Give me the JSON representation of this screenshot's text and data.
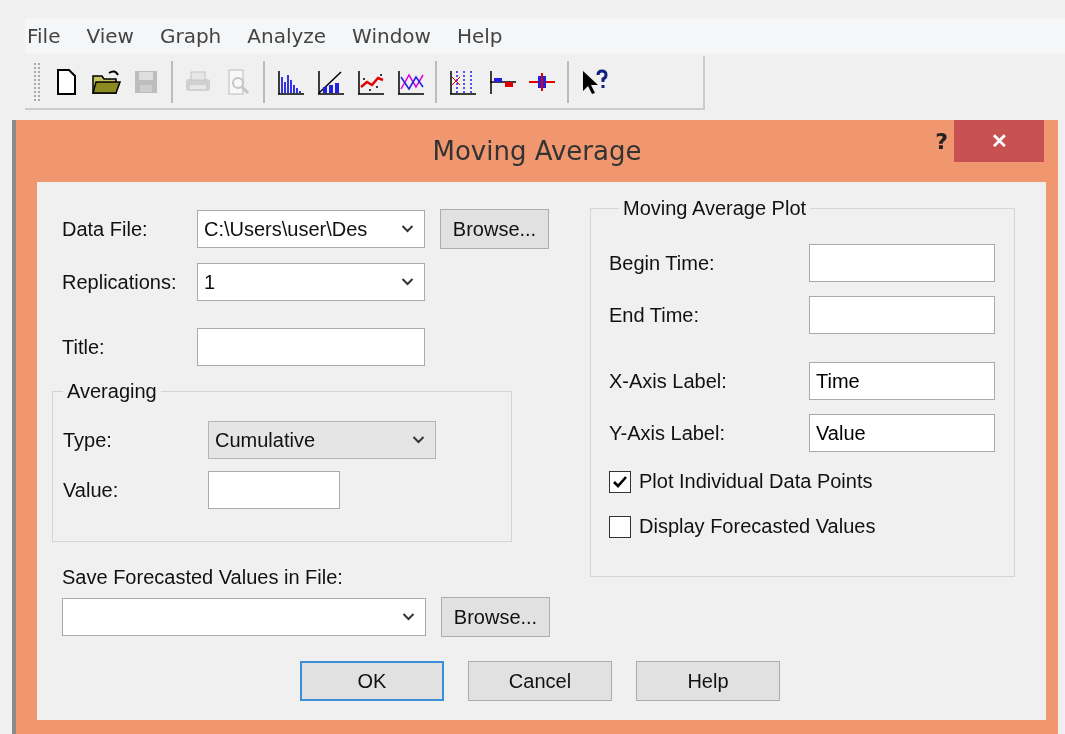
{
  "menu": [
    "File",
    "View",
    "Graph",
    "Analyze",
    "Window",
    "Help"
  ],
  "toolbar": [
    {
      "kind": "new",
      "disabled": false
    },
    {
      "kind": "open",
      "disabled": false
    },
    {
      "kind": "save",
      "disabled": true
    },
    {
      "kind": "sep"
    },
    {
      "kind": "print",
      "disabled": true
    },
    {
      "kind": "preview",
      "disabled": true
    },
    {
      "kind": "sep"
    },
    {
      "kind": "histogram",
      "disabled": false
    },
    {
      "kind": "barline",
      "disabled": false
    },
    {
      "kind": "scatterline",
      "disabled": false
    },
    {
      "kind": "lines",
      "disabled": false
    },
    {
      "kind": "sep"
    },
    {
      "kind": "grid",
      "disabled": false
    },
    {
      "kind": "steps",
      "disabled": false
    },
    {
      "kind": "errorbar",
      "disabled": false
    },
    {
      "kind": "sep"
    },
    {
      "kind": "whatsthis",
      "disabled": false
    }
  ],
  "dialog": {
    "title": "Moving Average",
    "help": "?",
    "close": "✕",
    "data_file": {
      "label": "Data File:",
      "value": "C:\\Users\\user\\Des",
      "browse": "Browse..."
    },
    "replications": {
      "label": "Replications:",
      "value": "1"
    },
    "title_field": {
      "label": "Title:"
    },
    "averaging": {
      "legend": "Averaging",
      "type_label": "Type:",
      "type_value": "Cumulative",
      "value_label": "Value:"
    },
    "save": {
      "label": "Save Forecasted Values in File:",
      "browse": "Browse..."
    },
    "plot": {
      "legend": "Moving Average Plot",
      "fields": [
        {
          "label": "Begin Time:"
        },
        {
          "label": "End Time:"
        },
        {
          "label": "X-Axis Label:",
          "value": "Time"
        },
        {
          "label": "Y-Axis Label:",
          "value": "Value"
        }
      ],
      "checkboxes": [
        {
          "label": "Plot Individual Data Points",
          "checked": true
        },
        {
          "label": "Display Forecasted Values",
          "checked": false
        }
      ]
    },
    "buttons": [
      {
        "label": "OK",
        "default": true
      },
      {
        "label": "Cancel",
        "default": false
      },
      {
        "label": "Help",
        "default": false
      }
    ]
  }
}
